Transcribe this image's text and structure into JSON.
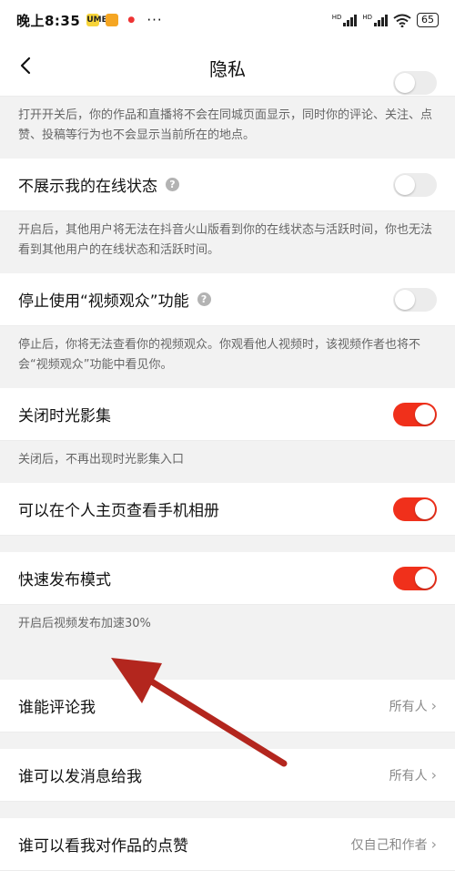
{
  "status_bar": {
    "time": "晚上8:35",
    "apps": [
      "UME",
      "",
      "●"
    ],
    "more": "···",
    "signal1_label": "HD",
    "signal2_label": "HD",
    "battery": "65"
  },
  "nav": {
    "title": "隐私",
    "back_icon": "chevron-left-icon"
  },
  "location_desc": "打开开关后，你的作品和直播将不会在同城页面显示，同时你的评论、关注、点赞、投稿等行为也不会显示当前所在的地点。",
  "settings": [
    {
      "label": "不展示我的在线状态",
      "help": "?",
      "on": false,
      "desc": "开启后，其他用户将无法在抖音火山版看到你的在线状态与活跃时间，你也无法看到其他用户的在线状态和活跃时间。"
    },
    {
      "label": "停止使用“视频观众”功能",
      "help": "?",
      "on": false,
      "desc": "停止后，你将无法查看你的视频观众。你观看他人视频时，该视频作者也将不会“视频观众”功能中看见你。"
    },
    {
      "label": "关闭时光影集",
      "on": true,
      "desc": "关闭后，不再出现时光影集入口"
    },
    {
      "label": "可以在个人主页查看手机相册",
      "on": true
    },
    {
      "label": "快速发布模式",
      "on": true,
      "desc": "开启后视频发布加速30%"
    }
  ],
  "permissions": [
    {
      "label": "谁能评论我",
      "value": "所有人"
    },
    {
      "label": "谁可以发消息给我",
      "value": "所有人"
    },
    {
      "label": "谁可以看我对作品的点赞",
      "value": "仅自己和作者"
    }
  ],
  "colors": {
    "accent": "#f0301b",
    "annotation_arrow": "#b3261e"
  }
}
